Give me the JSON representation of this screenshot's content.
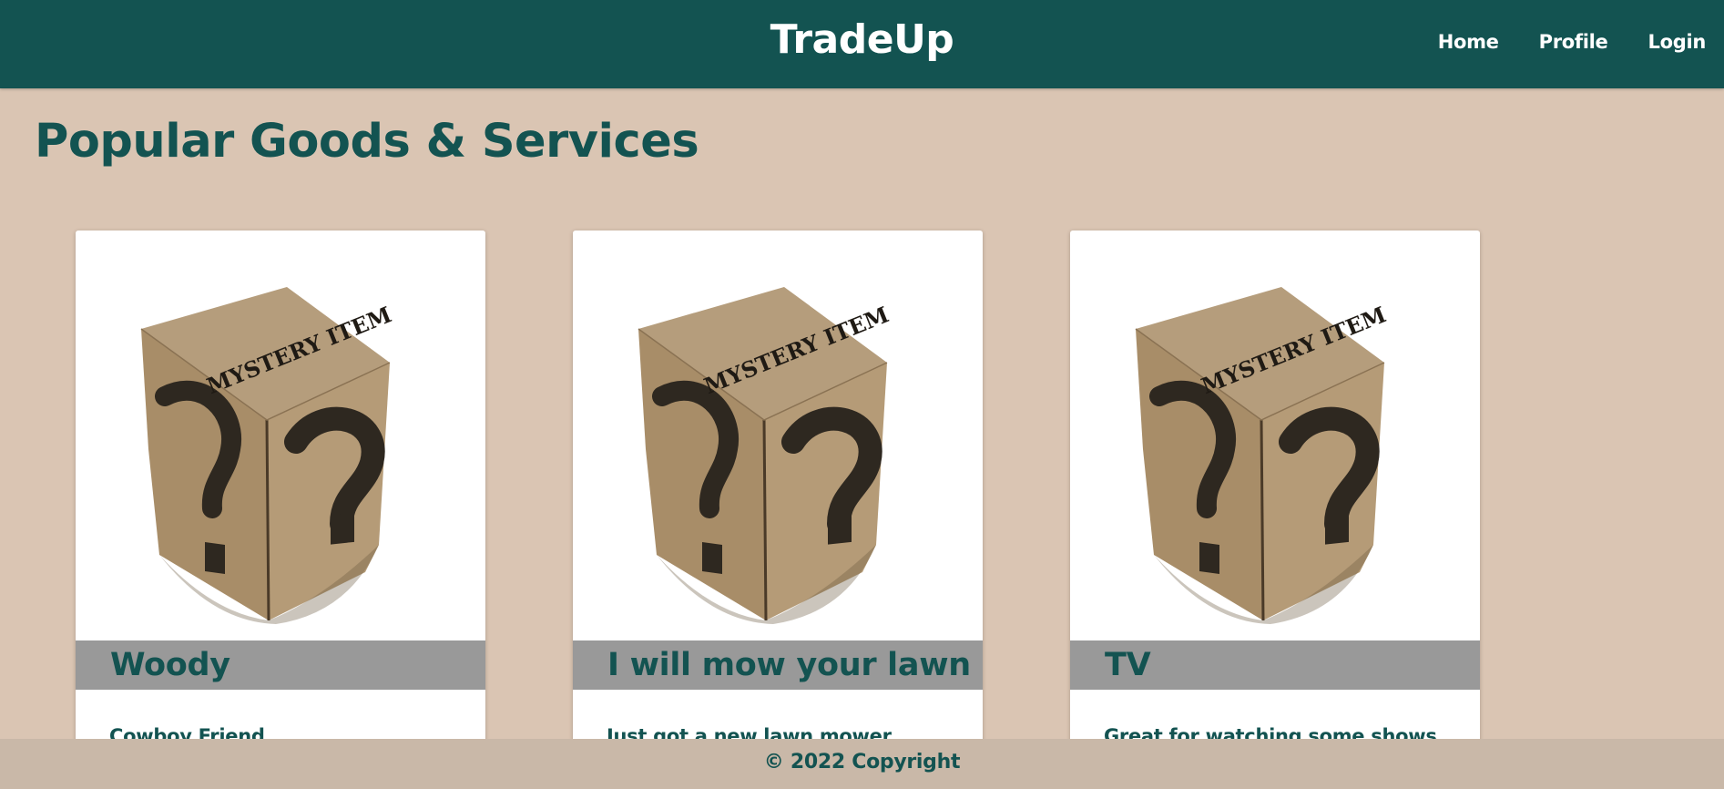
{
  "header": {
    "brand": "TradeUp",
    "nav": [
      {
        "label": "Home"
      },
      {
        "label": "Profile"
      },
      {
        "label": "Login"
      }
    ]
  },
  "main": {
    "title": "Popular Goods & Services",
    "image_label": "MYSTERY ITEM",
    "cards": [
      {
        "name": "Woody",
        "description": "Cowboy Friend",
        "image": "mystery-box-image"
      },
      {
        "name": "I will mow your lawn",
        "description": "Just got a new lawn mower",
        "image": "mystery-box-image"
      },
      {
        "name": "TV",
        "description": "Great for watching some shows",
        "image": "mystery-box-image"
      }
    ]
  },
  "footer": {
    "text": "© 2022 Copyright"
  },
  "colors": {
    "header_bg": "#135351",
    "page_bg": "#dac5b3",
    "accent_text": "#135351",
    "card_name_bar": "#999999",
    "footer_bg": "#c9b8a8"
  }
}
